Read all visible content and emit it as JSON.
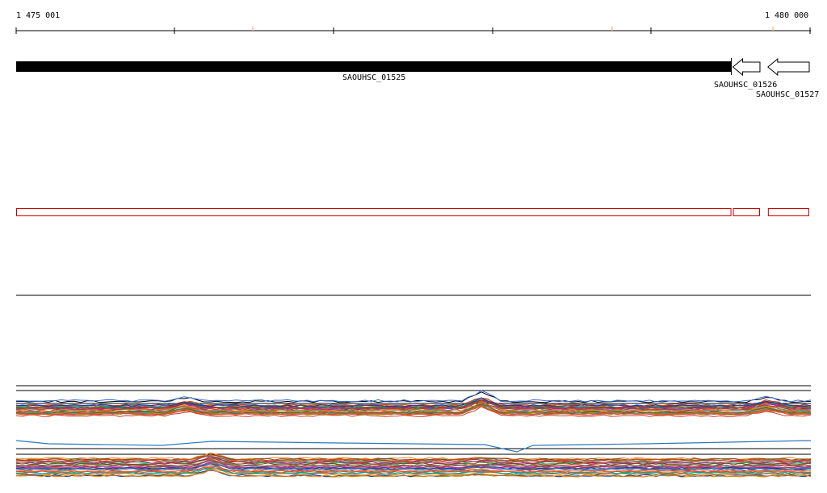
{
  "ruler": {
    "start_label": "1 475 001",
    "end_label": "1 480 000",
    "start": 1475001,
    "end": 1480000
  },
  "genes": [
    {
      "id": "SAOUHSC_01525",
      "start": 1475001,
      "end": 1479510,
      "strand": "+",
      "selected": true
    },
    {
      "id": "SAOUHSC_01526",
      "start": 1479510,
      "end": 1479690,
      "strand": "-",
      "selected": false
    },
    {
      "id": "SAOUHSC_01527",
      "start": 1479730,
      "end": 1480000,
      "strand": "-",
      "selected": false
    }
  ],
  "colors": {
    "selected_gene": "#000000",
    "gene_outline": "#000000",
    "annotation_outline": "#cc0000",
    "tick_highlight": "#f4c09a"
  }
}
